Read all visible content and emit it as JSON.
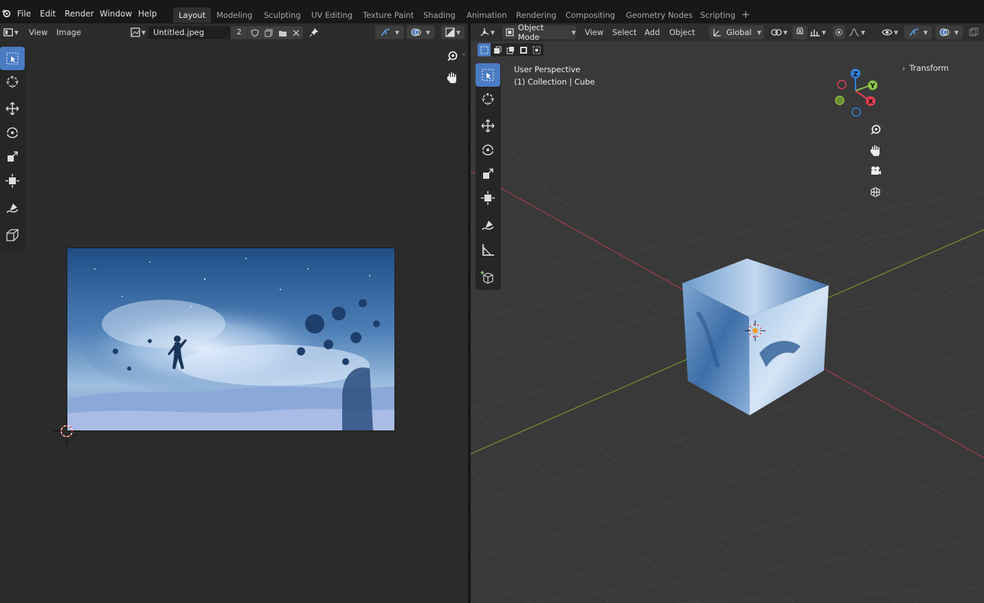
{
  "menu": [
    "File",
    "Edit",
    "Render",
    "Window",
    "Help"
  ],
  "workspaces": [
    "Layout",
    "Modeling",
    "Sculpting",
    "UV Editing",
    "Texture Paint",
    "Shading",
    "Animation",
    "Rendering",
    "Compositing",
    "Geometry Nodes",
    "Scripting"
  ],
  "active_workspace": "Layout",
  "image_editor": {
    "menus": [
      "View",
      "Image"
    ],
    "image_name": "Untitled.jpeg",
    "users": "2"
  },
  "viewport": {
    "mode": "Object Mode",
    "menus": [
      "View",
      "Select",
      "Add",
      "Object"
    ],
    "orientation": "Global",
    "perspective_label": "User Perspective",
    "collection_label": "(1) Collection | Cube",
    "sidebar_panel": "Transform",
    "gizmo_axes": {
      "z": "Z",
      "y": "Y",
      "x": "X"
    }
  },
  "colors": {
    "accent": "#4a7cc4",
    "axis_x": "#e53d51",
    "axis_y": "#8bc34a",
    "axis_z": "#2f84e3"
  }
}
